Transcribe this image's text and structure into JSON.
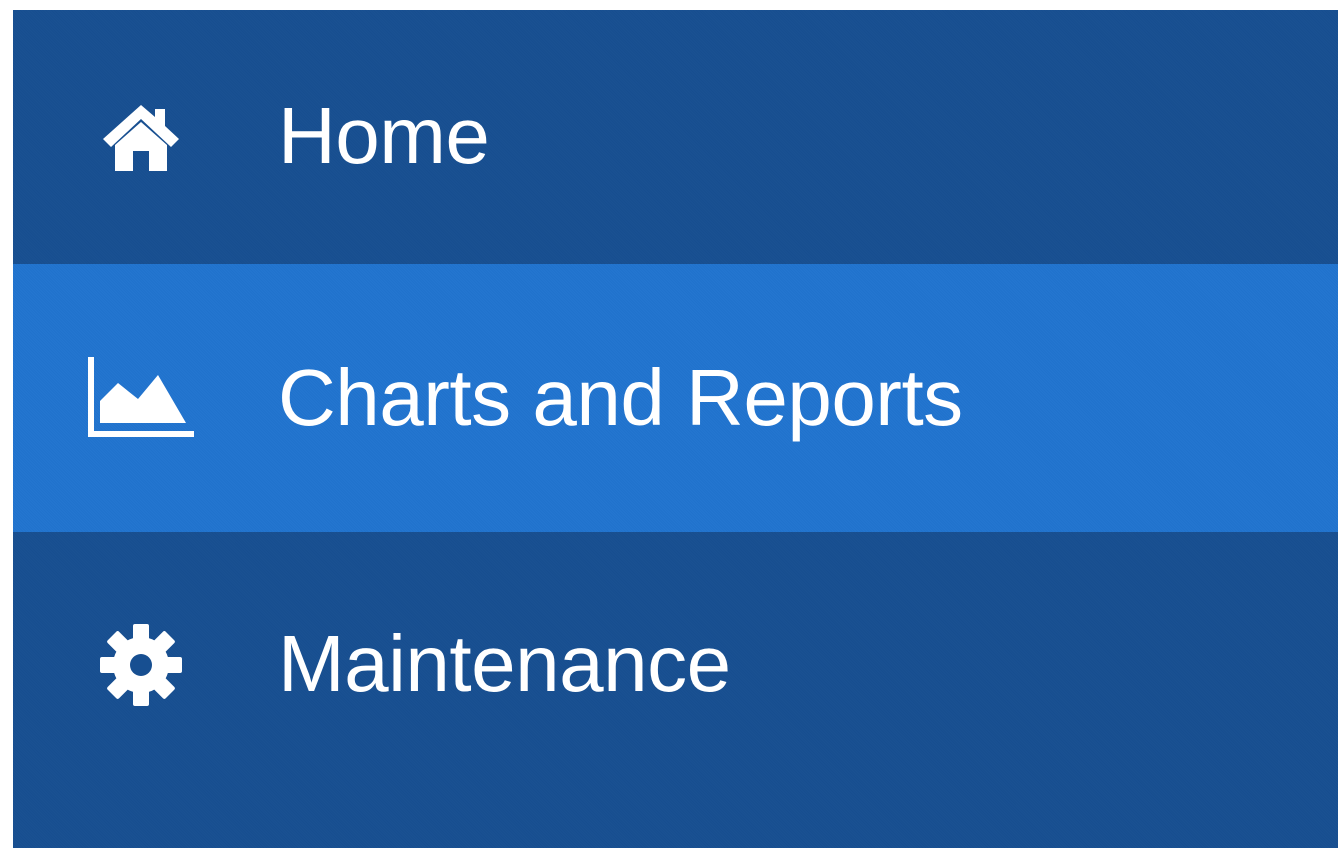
{
  "colors": {
    "nav_background": "#174f91",
    "active_background": "#2174cf",
    "text": "#ffffff"
  },
  "nav": {
    "items": [
      {
        "label": "Home",
        "icon": "home-icon",
        "active": false
      },
      {
        "label": "Charts and Reports",
        "icon": "area-chart-icon",
        "active": true
      },
      {
        "label": "Maintenance",
        "icon": "gear-icon",
        "active": false
      }
    ]
  }
}
